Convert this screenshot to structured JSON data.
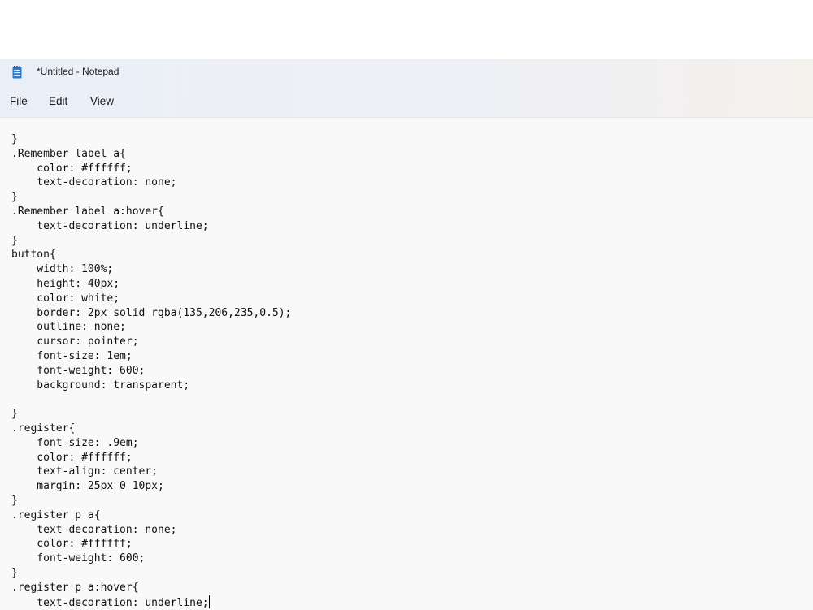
{
  "window": {
    "title": "*Untitled - Notepad"
  },
  "menu": {
    "file": "File",
    "edit": "Edit",
    "view": "View"
  },
  "editor": {
    "lines": [
      "}",
      ".Remember label a{",
      "    color: #ffffff;",
      "    text-decoration: none;",
      "}",
      ".Remember label a:hover{",
      "    text-decoration: underline;",
      "}",
      "button{",
      "    width: 100%;",
      "    height: 40px;",
      "    color: white;",
      "    border: 2px solid rgba(135,206,235,0.5);",
      "    outline: none;",
      "    cursor: pointer;",
      "    font-size: 1em;",
      "    font-weight: 600;",
      "    background: transparent;",
      "",
      "}",
      ".register{",
      "    font-size: .9em;",
      "    color: #ffffff;",
      "    text-align: center;",
      "    margin: 25px 0 10px;",
      "}",
      ".register p a{",
      "    text-decoration: none;",
      "    color: #ffffff;",
      "    font-weight: 600;",
      "}",
      ".register p a:hover{",
      "    text-decoration: underline;"
    ]
  },
  "icons": {
    "app": "notepad-icon"
  },
  "colors": {
    "editor_bg": "#f9f9f9",
    "titlebar_bg": "#eef0f6",
    "text": "#111111",
    "icon_blue": "#1f6fc5"
  }
}
